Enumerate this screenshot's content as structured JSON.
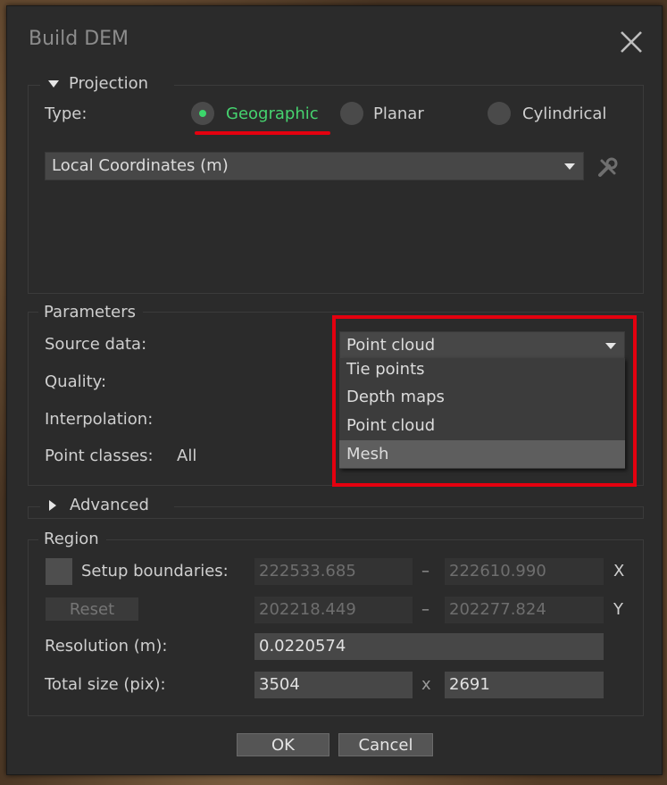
{
  "dialog": {
    "title": "Build DEM",
    "ok_label": "OK",
    "cancel_label": "Cancel"
  },
  "projection": {
    "section_label": "Projection",
    "type_label": "Type:",
    "options": [
      "Geographic",
      "Planar",
      "Cylindrical"
    ],
    "selected": "Geographic",
    "coordinate_system": "Local Coordinates (m)"
  },
  "parameters": {
    "section_label": "Parameters",
    "source_data_label": "Source data:",
    "source_data_value": "Point cloud",
    "source_data_options": [
      "Tie points",
      "Depth maps",
      "Point cloud",
      "Mesh"
    ],
    "hovered_option": "Mesh",
    "quality_label": "Quality:",
    "interpolation_label": "Interpolation:",
    "point_classes_label": "Point classes:",
    "point_classes_value": "All"
  },
  "advanced": {
    "section_label": "Advanced"
  },
  "region": {
    "section_label": "Region",
    "setup_boundaries_label": "Setup boundaries:",
    "reset_label": "Reset",
    "x_min": "222533.685",
    "x_max": "222610.990",
    "y_min": "202218.449",
    "y_max": "202277.824",
    "range_separator": "–",
    "x_axis_label": "X",
    "y_axis_label": "Y",
    "resolution_label": "Resolution (m):",
    "resolution_value": "0.0220574",
    "total_size_label": "Total size (pix):",
    "width_value": "3504",
    "height_value": "2691",
    "size_separator": "x"
  },
  "colors": {
    "selected_radio": "#46d36f",
    "annotation_red": "#e4000f"
  }
}
